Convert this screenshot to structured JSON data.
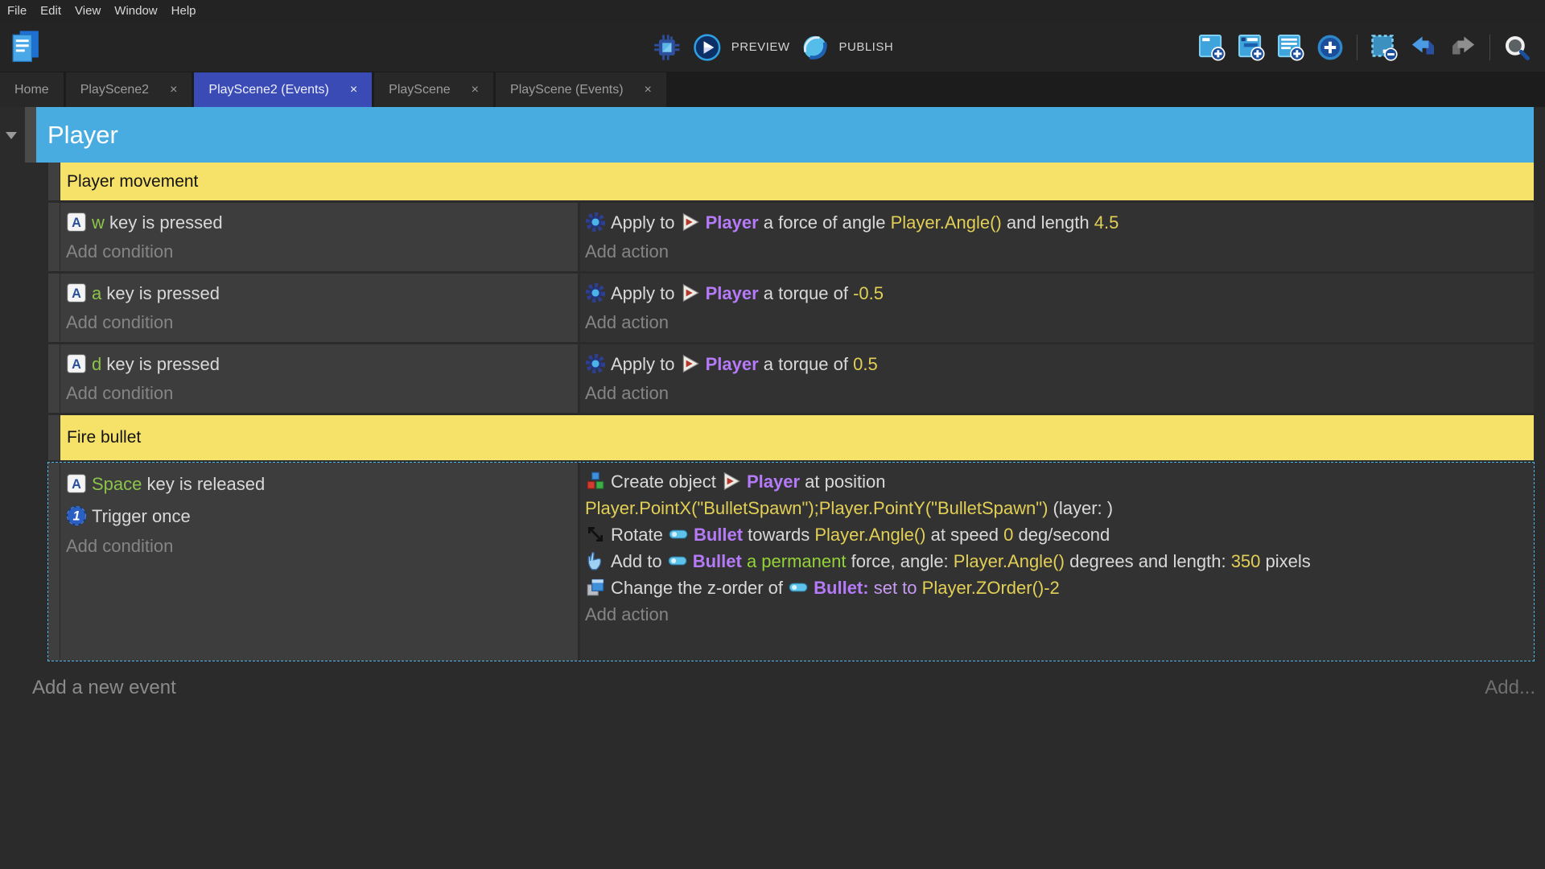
{
  "menu_bar": {
    "items": [
      "File",
      "Edit",
      "View",
      "Window",
      "Help"
    ]
  },
  "toolbar": {
    "left_icons": [
      "project-manager-icon"
    ],
    "preview_label": "PREVIEW",
    "publish_label": "PUBLISH",
    "center_icons": [
      "debug-icon",
      "preview-icon",
      "publish-icon"
    ],
    "right_icons": [
      "add-event-icon",
      "add-subevent-icon",
      "add-comment-icon",
      "add-circle-icon",
      "separator",
      "select-remove-icon",
      "undo-icon",
      "redo-icon",
      "separator",
      "search-icon"
    ]
  },
  "tabs": [
    {
      "label": "Home",
      "closable": false,
      "active": false
    },
    {
      "label": "PlayScene2",
      "closable": true,
      "active": false
    },
    {
      "label": "PlayScene2 (Events)",
      "closable": true,
      "active": true
    },
    {
      "label": "PlayScene",
      "closable": true,
      "active": false
    },
    {
      "label": "PlayScene (Events)",
      "closable": true,
      "active": false
    }
  ],
  "colors": {
    "group_header_blue": "#49ace1",
    "comment_yellow": "#f6e269",
    "active_tab_indigo": "#3a4bb5",
    "selection_dashed_cyan": "#4fb6e8",
    "object_purple": "#b57af7",
    "expression_yellow": "#e2cf55",
    "key_green": "#8bc34a"
  },
  "events": {
    "group_title": "Player",
    "add_condition_label": "Add condition",
    "add_action_label": "Add action",
    "rows": [
      {
        "type": "comment",
        "text": "Player movement"
      },
      {
        "type": "event",
        "selected": false,
        "conditions": [
          {
            "segs": [
              {
                "icon": "key-icon"
              },
              [
                "w",
                "key"
              ],
              [
                " key is pressed",
                "plain"
              ]
            ]
          }
        ],
        "actions": [
          {
            "segs": [
              {
                "icon": "gear-icon"
              },
              [
                "Apply to ",
                "plain"
              ],
              {
                "icon": "player-icon"
              },
              [
                "Player",
                "obj"
              ],
              [
                " a force of angle ",
                "plain"
              ],
              [
                "Player.Angle()",
                "expr"
              ],
              [
                " and length ",
                "plain"
              ],
              [
                "4.5",
                "expr"
              ]
            ]
          }
        ]
      },
      {
        "type": "event",
        "selected": false,
        "conditions": [
          {
            "segs": [
              {
                "icon": "key-icon"
              },
              [
                "a",
                "key"
              ],
              [
                " key is pressed",
                "plain"
              ]
            ]
          }
        ],
        "actions": [
          {
            "segs": [
              {
                "icon": "gear-icon"
              },
              [
                "Apply to ",
                "plain"
              ],
              {
                "icon": "player-icon"
              },
              [
                "Player",
                "obj"
              ],
              [
                " a torque of ",
                "plain"
              ],
              [
                "-0.5",
                "expr"
              ]
            ]
          }
        ]
      },
      {
        "type": "event",
        "selected": false,
        "conditions": [
          {
            "segs": [
              {
                "icon": "key-icon"
              },
              [
                "d",
                "key"
              ],
              [
                " key is pressed",
                "plain"
              ]
            ]
          }
        ],
        "actions": [
          {
            "segs": [
              {
                "icon": "gear-icon"
              },
              [
                "Apply to ",
                "plain"
              ],
              {
                "icon": "player-icon"
              },
              [
                "Player",
                "obj"
              ],
              [
                " a torque of ",
                "plain"
              ],
              [
                "0.5",
                "expr"
              ]
            ]
          }
        ]
      },
      {
        "type": "comment",
        "text": "Fire bullet",
        "tall": true
      },
      {
        "type": "event",
        "selected": true,
        "conditions": [
          {
            "segs": [
              {
                "icon": "key-icon"
              },
              [
                "Space",
                "key"
              ],
              [
                " key is released",
                "plain"
              ]
            ]
          },
          {
            "segs": [
              {
                "icon": "trigger-once-icon"
              },
              [
                "Trigger once",
                "plain"
              ]
            ]
          }
        ],
        "actions": [
          {
            "segs": [
              {
                "icon": "create-object-icon"
              },
              [
                "Create object ",
                "plain"
              ],
              {
                "icon": "player-icon"
              },
              [
                "Player",
                "obj"
              ],
              [
                " at position ",
                "plain"
              ],
              {
                "br": true
              },
              [
                "Player.PointX(\"BulletSpawn\");Player.PointY(\"BulletSpawn\")",
                "expr"
              ],
              [
                " (layer: )",
                "plain"
              ]
            ]
          },
          {
            "segs": [
              {
                "icon": "rotate-icon"
              },
              [
                "Rotate ",
                "plain"
              ],
              {
                "icon": "bullet-icon"
              },
              [
                "Bullet",
                "obj"
              ],
              [
                " towards ",
                "plain"
              ],
              [
                "Player.Angle()",
                "expr"
              ],
              [
                " at speed ",
                "plain"
              ],
              [
                "0",
                "expr"
              ],
              [
                " deg/second",
                "plain"
              ]
            ]
          },
          {
            "segs": [
              {
                "icon": "force-icon"
              },
              [
                "Add to ",
                "plain"
              ],
              {
                "icon": "bullet-icon"
              },
              [
                "Bullet",
                "obj"
              ],
              [
                " a permanent ",
                "perm"
              ],
              [
                "force, angle: ",
                "plain"
              ],
              [
                "Player.Angle()",
                "expr"
              ],
              [
                " degrees and length: ",
                "plain"
              ],
              [
                "350",
                "expr"
              ],
              [
                " pixels",
                "plain"
              ]
            ]
          },
          {
            "segs": [
              {
                "icon": "zorder-icon"
              },
              [
                "Change the z-order of ",
                "plain"
              ],
              {
                "icon": "bullet-icon"
              },
              [
                "Bullet",
                "obj"
              ],
              [
                ": ",
                "obj"
              ],
              [
                "set to ",
                "setto"
              ],
              [
                "Player.ZOrder()-2",
                "expr"
              ]
            ]
          }
        ]
      }
    ]
  },
  "footer": {
    "add_new_event_label": "Add a new event",
    "add_button_label": "Add..."
  }
}
